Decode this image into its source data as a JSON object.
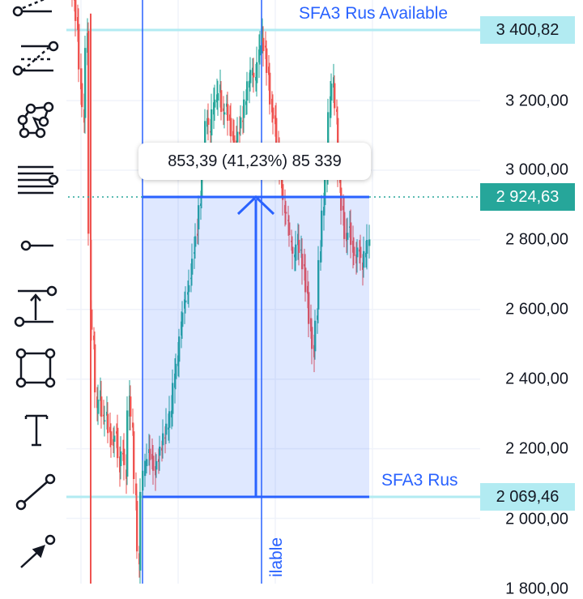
{
  "price_axis": {
    "ticks": [
      "3 200,00",
      "3 000,00",
      "2 800,00",
      "2 600,00",
      "2 400,00",
      "2 200,00",
      "2 000,00",
      "1 800,00"
    ]
  },
  "price_tags": {
    "upper_level": "3 400,82",
    "current_price": "2 924,63",
    "lower_level": "2 069,46"
  },
  "levels": {
    "upper_label": "SFA3 Rus Available",
    "lower_label": "SFA3 Rus",
    "vertical_label": "ilable"
  },
  "measure": {
    "readout": "853,39 (41,23%) 85 339"
  },
  "colors": {
    "up": "#26a69a",
    "down": "#ef5350",
    "accent": "#2962ff",
    "level_line": "#b2ebf2",
    "current_tag": "#26a69a"
  },
  "toolbar": {
    "tools": [
      {
        "icon": "trend-angle-icon"
      },
      {
        "icon": "fib-retracement-icon"
      },
      {
        "icon": "pattern-icon"
      },
      {
        "icon": "horizontal-lines-icon"
      },
      {
        "icon": "horizontal-ray-icon"
      },
      {
        "icon": "price-range-icon"
      },
      {
        "icon": "rectangle-icon"
      },
      {
        "icon": "text-icon"
      },
      {
        "icon": "trend-line-icon"
      },
      {
        "icon": "arrow-icon"
      }
    ]
  }
}
